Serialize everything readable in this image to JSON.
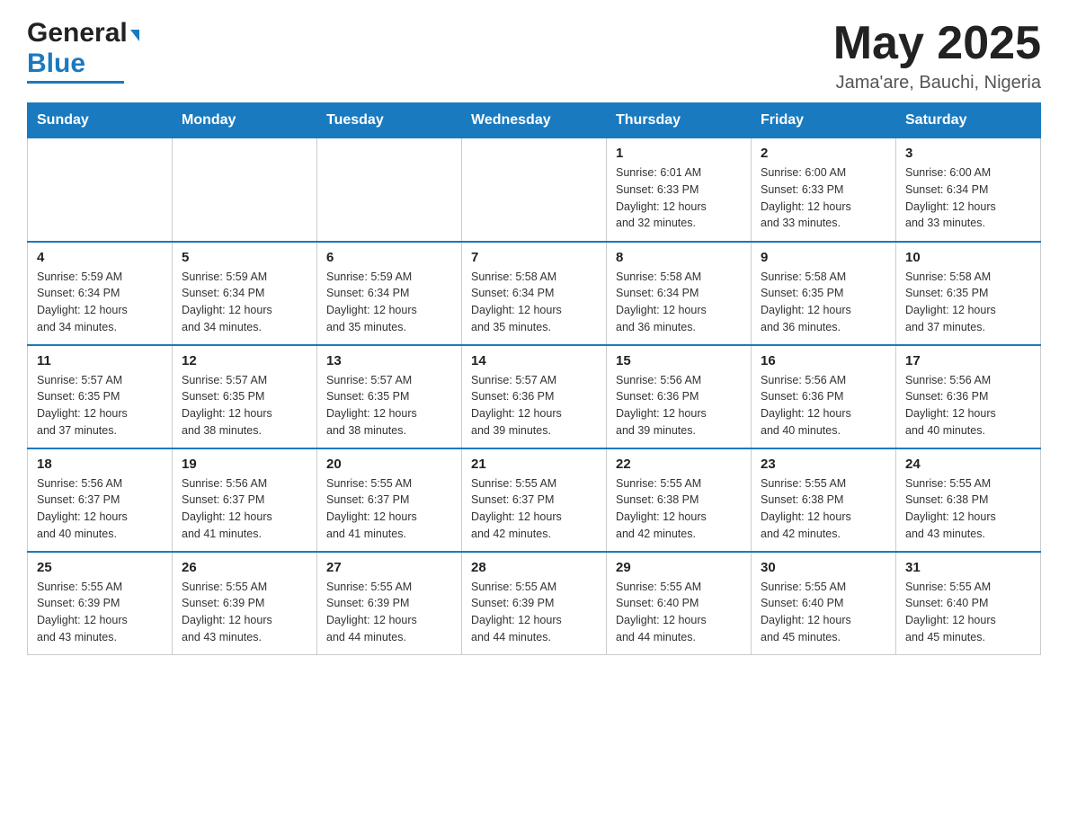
{
  "header": {
    "logo_general": "General",
    "logo_blue": "Blue",
    "month_year": "May 2025",
    "location": "Jama'are, Bauchi, Nigeria"
  },
  "weekdays": [
    "Sunday",
    "Monday",
    "Tuesday",
    "Wednesday",
    "Thursday",
    "Friday",
    "Saturday"
  ],
  "weeks": [
    [
      {
        "day": "",
        "info": ""
      },
      {
        "day": "",
        "info": ""
      },
      {
        "day": "",
        "info": ""
      },
      {
        "day": "",
        "info": ""
      },
      {
        "day": "1",
        "info": "Sunrise: 6:01 AM\nSunset: 6:33 PM\nDaylight: 12 hours\nand 32 minutes."
      },
      {
        "day": "2",
        "info": "Sunrise: 6:00 AM\nSunset: 6:33 PM\nDaylight: 12 hours\nand 33 minutes."
      },
      {
        "day": "3",
        "info": "Sunrise: 6:00 AM\nSunset: 6:34 PM\nDaylight: 12 hours\nand 33 minutes."
      }
    ],
    [
      {
        "day": "4",
        "info": "Sunrise: 5:59 AM\nSunset: 6:34 PM\nDaylight: 12 hours\nand 34 minutes."
      },
      {
        "day": "5",
        "info": "Sunrise: 5:59 AM\nSunset: 6:34 PM\nDaylight: 12 hours\nand 34 minutes."
      },
      {
        "day": "6",
        "info": "Sunrise: 5:59 AM\nSunset: 6:34 PM\nDaylight: 12 hours\nand 35 minutes."
      },
      {
        "day": "7",
        "info": "Sunrise: 5:58 AM\nSunset: 6:34 PM\nDaylight: 12 hours\nand 35 minutes."
      },
      {
        "day": "8",
        "info": "Sunrise: 5:58 AM\nSunset: 6:34 PM\nDaylight: 12 hours\nand 36 minutes."
      },
      {
        "day": "9",
        "info": "Sunrise: 5:58 AM\nSunset: 6:35 PM\nDaylight: 12 hours\nand 36 minutes."
      },
      {
        "day": "10",
        "info": "Sunrise: 5:58 AM\nSunset: 6:35 PM\nDaylight: 12 hours\nand 37 minutes."
      }
    ],
    [
      {
        "day": "11",
        "info": "Sunrise: 5:57 AM\nSunset: 6:35 PM\nDaylight: 12 hours\nand 37 minutes."
      },
      {
        "day": "12",
        "info": "Sunrise: 5:57 AM\nSunset: 6:35 PM\nDaylight: 12 hours\nand 38 minutes."
      },
      {
        "day": "13",
        "info": "Sunrise: 5:57 AM\nSunset: 6:35 PM\nDaylight: 12 hours\nand 38 minutes."
      },
      {
        "day": "14",
        "info": "Sunrise: 5:57 AM\nSunset: 6:36 PM\nDaylight: 12 hours\nand 39 minutes."
      },
      {
        "day": "15",
        "info": "Sunrise: 5:56 AM\nSunset: 6:36 PM\nDaylight: 12 hours\nand 39 minutes."
      },
      {
        "day": "16",
        "info": "Sunrise: 5:56 AM\nSunset: 6:36 PM\nDaylight: 12 hours\nand 40 minutes."
      },
      {
        "day": "17",
        "info": "Sunrise: 5:56 AM\nSunset: 6:36 PM\nDaylight: 12 hours\nand 40 minutes."
      }
    ],
    [
      {
        "day": "18",
        "info": "Sunrise: 5:56 AM\nSunset: 6:37 PM\nDaylight: 12 hours\nand 40 minutes."
      },
      {
        "day": "19",
        "info": "Sunrise: 5:56 AM\nSunset: 6:37 PM\nDaylight: 12 hours\nand 41 minutes."
      },
      {
        "day": "20",
        "info": "Sunrise: 5:55 AM\nSunset: 6:37 PM\nDaylight: 12 hours\nand 41 minutes."
      },
      {
        "day": "21",
        "info": "Sunrise: 5:55 AM\nSunset: 6:37 PM\nDaylight: 12 hours\nand 42 minutes."
      },
      {
        "day": "22",
        "info": "Sunrise: 5:55 AM\nSunset: 6:38 PM\nDaylight: 12 hours\nand 42 minutes."
      },
      {
        "day": "23",
        "info": "Sunrise: 5:55 AM\nSunset: 6:38 PM\nDaylight: 12 hours\nand 42 minutes."
      },
      {
        "day": "24",
        "info": "Sunrise: 5:55 AM\nSunset: 6:38 PM\nDaylight: 12 hours\nand 43 minutes."
      }
    ],
    [
      {
        "day": "25",
        "info": "Sunrise: 5:55 AM\nSunset: 6:39 PM\nDaylight: 12 hours\nand 43 minutes."
      },
      {
        "day": "26",
        "info": "Sunrise: 5:55 AM\nSunset: 6:39 PM\nDaylight: 12 hours\nand 43 minutes."
      },
      {
        "day": "27",
        "info": "Sunrise: 5:55 AM\nSunset: 6:39 PM\nDaylight: 12 hours\nand 44 minutes."
      },
      {
        "day": "28",
        "info": "Sunrise: 5:55 AM\nSunset: 6:39 PM\nDaylight: 12 hours\nand 44 minutes."
      },
      {
        "day": "29",
        "info": "Sunrise: 5:55 AM\nSunset: 6:40 PM\nDaylight: 12 hours\nand 44 minutes."
      },
      {
        "day": "30",
        "info": "Sunrise: 5:55 AM\nSunset: 6:40 PM\nDaylight: 12 hours\nand 45 minutes."
      },
      {
        "day": "31",
        "info": "Sunrise: 5:55 AM\nSunset: 6:40 PM\nDaylight: 12 hours\nand 45 minutes."
      }
    ]
  ]
}
